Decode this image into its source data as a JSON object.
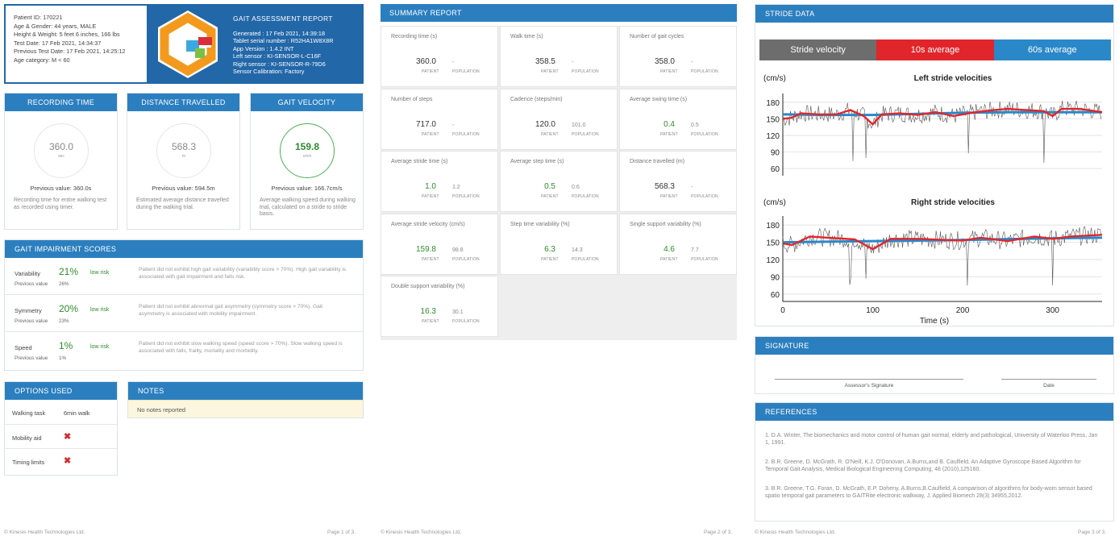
{
  "header": {
    "patient_lines": [
      "Patient ID: 170221",
      "Age & Gender: 44 years, MALE",
      "Height & Weight: 5 feet 6 inches, 166 lbs",
      "Test Date: 17 Feb 2021, 14:34:37",
      "Previous Test Date: 17 Feb 2021, 14:25:12",
      "Age category: M < 60"
    ],
    "title": "GAIT ASSESSMENT REPORT",
    "meta_lines": [
      "Generated : 17 Feb 2021, 14:39:18",
      "Tablet serial number : R52HA1W8X8R",
      "App Version : 1.4.2 INT",
      "Left sensor : KI-SENSOR-L-C16F",
      "Right sensor : KI-SENSOR-R-79D6",
      "Sensor Calibration: Factory"
    ]
  },
  "metrics": [
    {
      "title": "RECORDING TIME",
      "value": "360.0",
      "unit": "sec",
      "previous": "Previous value: 360.0s",
      "desc": "Recording time for entire walking test as recorded using timer."
    },
    {
      "title": "DISTANCE TRAVELLED",
      "value": "568.3",
      "unit": "m",
      "previous": "Previous value: 594.5m",
      "desc": "Estimated average distance travelled during the walking trial."
    },
    {
      "title": "GAIT VELOCITY",
      "value": "159.8",
      "unit": "cm/s",
      "previous": "Previous value: 166.7cm/s",
      "desc": "Average walking speed during walking trial, calculated on a stride to stride basis."
    }
  ],
  "impairment": {
    "title": "GAIT IMPAIRMENT SCORES",
    "prev_label": "Previous value",
    "rows": [
      {
        "name": "Variability",
        "pct": "21%",
        "prev": "26%",
        "risk": "low risk",
        "text": "Patient did not exhibit high gait variability (variability score > 70%). High gait variability is associated with gait impairment and falls risk."
      },
      {
        "name": "Symmetry",
        "pct": "20%",
        "prev": "23%",
        "risk": "low risk",
        "text": "Patient did not exhibit abnormal gait asymmetry (symmetry score > 70%). Gait asymmetry is associated with mobility impairment."
      },
      {
        "name": "Speed",
        "pct": "1%",
        "prev": "1%",
        "risk": "low risk",
        "text": "Patient did not exhibit slow walking speed (speed score > 70%). Slow walking speed is associated with falls, frailty, mortality and morbidity."
      }
    ]
  },
  "options": {
    "title": "OPTIONS USED",
    "walking_task_label": "Walking task",
    "walking_task_value": "6min walk",
    "mobility_aid_label": "Mobility aid",
    "timing_limits_label": "Timing limits",
    "cross": "✖"
  },
  "notes": {
    "title": "NOTES",
    "text": "No notes reported"
  },
  "footer": {
    "company": "© Kinesis Health Technologies Ltd.",
    "page1": "Page 1 of 3.",
    "page2": "Page 2 of 3.",
    "page3": "Page 3 of 3."
  },
  "summary": {
    "title": "SUMMARY REPORT",
    "patient_label": "PATIENT",
    "population_label": "POPULATION",
    "cells": [
      {
        "label": "Recording time (s)",
        "patient": "360.0",
        "population": "-",
        "green": false
      },
      {
        "label": "Walk time (s)",
        "patient": "358.5",
        "population": "-",
        "green": false
      },
      {
        "label": "Number of gait cycles",
        "patient": "358.0",
        "population": "-",
        "green": false
      },
      {
        "label": "Number of steps",
        "patient": "717.0",
        "population": "-",
        "green": false
      },
      {
        "label": "Cadence (steps/min)",
        "patient": "120.0",
        "population": "101.0",
        "green": false
      },
      {
        "label": "Average swing time (s)",
        "patient": "0.4",
        "population": "0.5",
        "green": true
      },
      {
        "label": "Average stride time (s)",
        "patient": "1.0",
        "population": "1.2",
        "green": true
      },
      {
        "label": "Average step time (s)",
        "patient": "0.5",
        "population": "0.6",
        "green": true
      },
      {
        "label": "Distance travelled (m)",
        "patient": "568.3",
        "population": "-",
        "green": false
      },
      {
        "label": "Average stride velocity (cm/s)",
        "patient": "159.8",
        "population": "98.8",
        "green": true
      },
      {
        "label": "Step time variability (%)",
        "patient": "6.3",
        "population": "14.3",
        "green": true
      },
      {
        "label": "Single support variability (%)",
        "patient": "4.6",
        "population": "7.7",
        "green": true
      },
      {
        "label": "Double support variability (%)",
        "patient": "16.3",
        "population": "30.1",
        "green": true
      }
    ]
  },
  "stride": {
    "title": "STRIDE DATA",
    "legend": [
      {
        "label": "Stride velocity",
        "color": "#6d6d6d"
      },
      {
        "label": "10s average",
        "color": "#e0262a"
      },
      {
        "label": "60s average",
        "color": "#2a88c9"
      }
    ]
  },
  "chart_data": [
    {
      "type": "line",
      "title": "Left stride velocities",
      "ylabel": "(cm/s)",
      "xlabel": "",
      "ylim": [
        50,
        190
      ],
      "xlim": [
        0,
        355
      ],
      "yticks": [
        60,
        90,
        120,
        150,
        180
      ],
      "series": [
        {
          "name": "10s average",
          "x": [
            0,
            10,
            20,
            40,
            60,
            75,
            90,
            100,
            110,
            130,
            150,
            170,
            190,
            210,
            230,
            250,
            270,
            290,
            300,
            310,
            330,
            355
          ],
          "values": [
            150,
            152,
            160,
            158,
            158,
            166,
            155,
            140,
            158,
            160,
            157,
            162,
            155,
            161,
            165,
            168,
            166,
            164,
            155,
            168,
            168,
            162
          ]
        },
        {
          "name": "60s average",
          "x": [
            0,
            50,
            100,
            150,
            200,
            250,
            300,
            355
          ],
          "values": [
            158,
            157,
            157,
            159,
            161,
            162,
            162,
            162
          ]
        }
      ]
    },
    {
      "type": "line",
      "title": "Right stride velocities",
      "ylabel": "(cm/s)",
      "xlabel": "Time (s)",
      "ylim": [
        50,
        190
      ],
      "xlim": [
        0,
        355
      ],
      "xticks": [
        0,
        100,
        200,
        300
      ],
      "yticks": [
        60,
        90,
        120,
        150,
        180
      ],
      "series": [
        {
          "name": "10s average",
          "x": [
            0,
            10,
            30,
            50,
            80,
            100,
            120,
            150,
            180,
            200,
            220,
            250,
            280,
            300,
            320,
            355
          ],
          "values": [
            148,
            145,
            160,
            158,
            155,
            138,
            156,
            156,
            154,
            153,
            158,
            152,
            160,
            156,
            160,
            163
          ]
        },
        {
          "name": "60s average",
          "x": [
            0,
            100,
            200,
            300,
            355
          ],
          "values": [
            150,
            152,
            154,
            157,
            158
          ]
        }
      ]
    }
  ],
  "signature": {
    "title": "SIGNATURE",
    "assessor": "Assessor's Signature",
    "date": "Date"
  },
  "references": {
    "title": "REFERENCES",
    "items": [
      "1. D.A. Winter, The biomechanics and motor control of human gait normal, elderly and pathological, University of Waterloo Press, Jan 1, 1991.",
      "2. B.R. Greene, D. McGrath, R. O'Neill, K.J. O'Donovan, A.Burns,and B. Caulfield, An Adaptive Gyroscope Based Algorithm for Temporal Gait Analysis, Medical Biological Engineering Computing, 48 (2010),125160.",
      "3. B.R. Greene, T.G. Foran, D. McGrath, E.P. Doheny, A.Burns,B.Caulfield, A comparison of algorithms for body-worn sensor based spatio temporal gait parameters to GAITRite electronic walkway, J. Applied Biomech 28(3) 34955,2012."
    ]
  }
}
